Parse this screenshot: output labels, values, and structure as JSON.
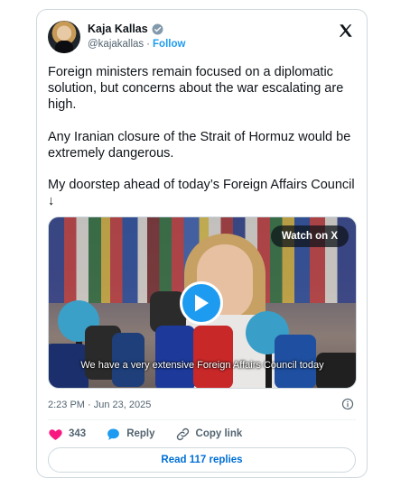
{
  "author": {
    "name": "Kaja Kallas",
    "handle": "@kajakallas",
    "separator": "·",
    "follow_label": "Follow"
  },
  "tweet": {
    "paragraphs": [
      "Foreign ministers remain focused on a diplomatic solution, but concerns about the war escalating are high.",
      "Any Iranian closure of the Strait of Hormuz would be extremely dangerous.",
      "My doorstep ahead of today’s Foreign Affairs Council ↓"
    ]
  },
  "media": {
    "watch_label": "Watch on X",
    "caption": "We have a very extensive Foreign Affairs Council today"
  },
  "meta": {
    "timestamp": "2:23 PM · Jun 23, 2025"
  },
  "actions": {
    "like_count": "343",
    "reply_label": "Reply",
    "copy_link_label": "Copy link"
  },
  "footer": {
    "read_replies_label": "Read 117 replies"
  },
  "colors": {
    "accent": "#1d9bf0",
    "like": "#f91880",
    "muted": "#536471",
    "link": "#006fd6"
  },
  "icons": {
    "verified": "verified-badge-icon",
    "logo": "x-logo-icon",
    "play": "play-icon",
    "info": "info-icon",
    "like": "heart-icon",
    "reply": "speech-bubble-icon",
    "copy_link": "link-icon"
  }
}
